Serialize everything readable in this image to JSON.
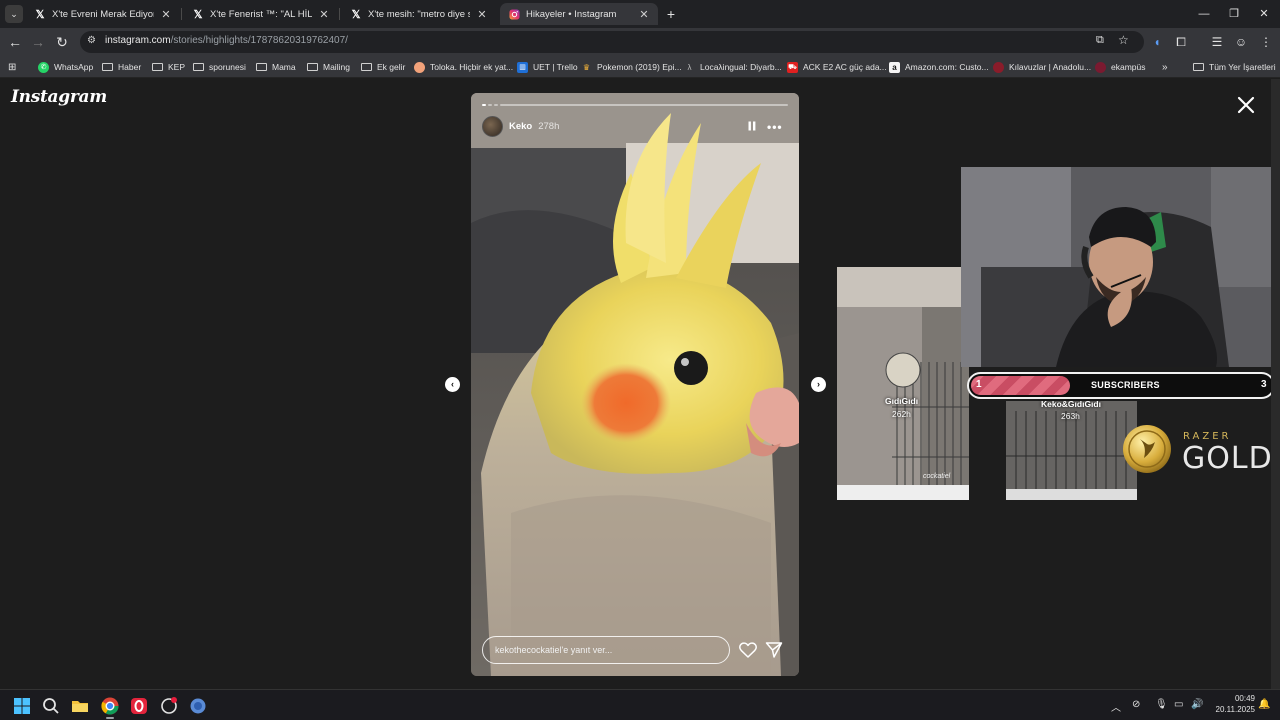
{
  "tabs": [
    {
      "label": "X'te Evreni Merak Ediyoruz: \"Ro",
      "icon": "x-logo-icon",
      "active": false
    },
    {
      "label": "X'te Fenerist ™: \"AL HİLAL'DEN",
      "icon": "x-logo-icon",
      "active": false
    },
    {
      "label": "X'te mesih: \"metro diye senin k",
      "icon": "x-logo-icon",
      "active": false
    },
    {
      "label": "Hikayeler • Instagram",
      "icon": "instagram-icon",
      "active": true
    }
  ],
  "address": {
    "host": "instagram.com",
    "path": "/stories/highlights/17878620319762407/"
  },
  "bookmarks": [
    {
      "label": "WhatsApp",
      "icon": "whatsapp-icon"
    },
    {
      "label": "Haber",
      "icon": "folder-icon"
    },
    {
      "label": "KEP",
      "icon": "folder-icon"
    },
    {
      "label": "sporunesi",
      "icon": "folder-icon"
    },
    {
      "label": "Mama",
      "icon": "folder-icon"
    },
    {
      "label": "Mailing",
      "icon": "folder-icon"
    },
    {
      "label": "Ek gelir",
      "icon": "folder-icon"
    },
    {
      "label": "Toloka. Hiçbir ek yat...",
      "icon": "toloka-icon"
    },
    {
      "label": "UET | Trello",
      "icon": "trello-icon"
    },
    {
      "label": "Pokemon (2019) Epi...",
      "icon": "crown-icon"
    },
    {
      "label": "Locaλingual: Diyarb...",
      "icon": "lambda-icon"
    },
    {
      "label": "ACK E2 AC güç ada...",
      "icon": "shop-icon"
    },
    {
      "label": "Amazon.com: Custo...",
      "icon": "amazon-icon"
    },
    {
      "label": "Kılavuzlar | Anadolu...",
      "icon": "anadolu-icon"
    },
    {
      "label": "ekampüs",
      "icon": "ekampus-icon"
    }
  ],
  "bookmarks_overflow": "»",
  "bookmarks_all": "Tüm Yer İşaretleri",
  "instagram": {
    "logo": "Instagram",
    "story": {
      "username": "Keko",
      "time": "278h",
      "reply_placeholder": "kekothecockatiel'e yanıt ver...",
      "segments_total": 4,
      "segments_seen": 1
    },
    "previews": [
      {
        "name": "GıdıGıdı",
        "time": "262h"
      },
      {
        "name": "Keko&GıdıGıdı",
        "time": "263h"
      }
    ],
    "cage_caption": "cockatiel"
  },
  "overlay": {
    "subs_current": "1",
    "subs_label": "SUBSCRIBERS",
    "subs_goal": "3",
    "subs_fraction": 0.33,
    "sponsor_top": "RAZER",
    "sponsor_main": "GOLD"
  },
  "taskbar": {
    "time": "00:49",
    "date": "20.11.2025"
  },
  "colors": {
    "page_bg": "#1d1d1d",
    "chrome_bg": "#35363a",
    "tabstrip_bg": "#202124",
    "subs_fill": "#e06b7e",
    "razer_gold": "#d4b65a"
  }
}
